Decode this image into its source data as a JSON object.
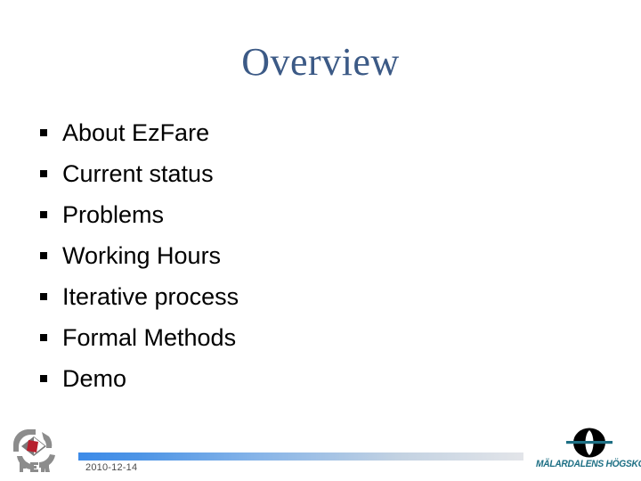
{
  "slide": {
    "title": "Overview",
    "title_color": "#3c5a86",
    "background_color": "#ffffff",
    "bullets": [
      {
        "label": "About EzFare"
      },
      {
        "label": "Current status"
      },
      {
        "label": "Problems"
      },
      {
        "label": "Working Hours"
      },
      {
        "label": "Iterative process"
      },
      {
        "label": "Formal Methods"
      },
      {
        "label": "Demo"
      }
    ]
  },
  "footer": {
    "date": "2010-12-14",
    "bar_color_start": "#3d8be8",
    "bar_color_end": "#e3e5e9",
    "left_logo": {
      "name": "fer-logo",
      "wordmark": "FER",
      "emblem_color": "#8c8c8c",
      "accent_color": "#b7202e"
    },
    "right_logo": {
      "name": "malardalen-hogskola-logo",
      "wordmark": "MÄLARDALENS HÖGSKOLA",
      "emblem_color": "#000000",
      "accent_color": "#1d6f84"
    }
  }
}
